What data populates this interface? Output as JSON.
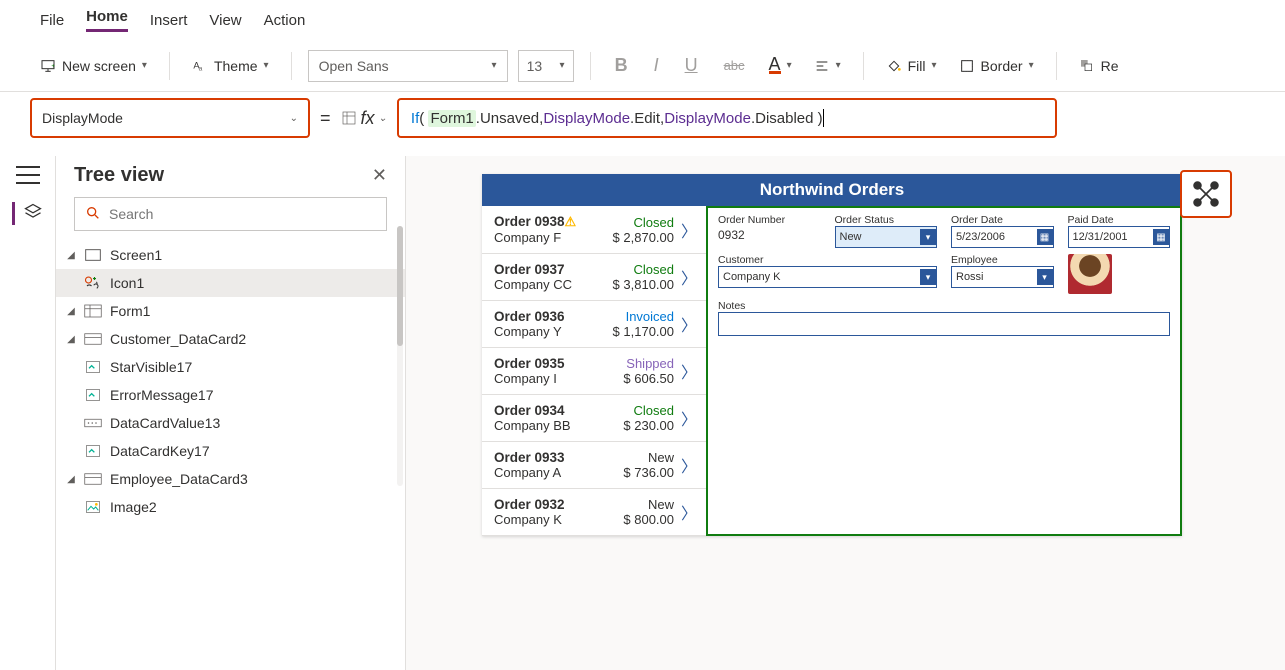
{
  "menu": {
    "file": "File",
    "home": "Home",
    "insert": "Insert",
    "view": "View",
    "action": "Action"
  },
  "toolbar": {
    "newscreen": "New screen",
    "theme": "Theme",
    "font": "Open Sans",
    "size": "13",
    "fill": "Fill",
    "border": "Border",
    "reorder": "Re"
  },
  "formula": {
    "property": "DisplayMode",
    "fn": "If",
    "id": "Form1",
    "txt1": ".Unsaved, ",
    "enum1": "DisplayMode",
    "txt2": ".Edit, ",
    "enum2": "DisplayMode",
    "txt3": ".Disabled )"
  },
  "tree": {
    "title": "Tree view",
    "search_ph": "Search",
    "screen1": "Screen1",
    "icon1": "Icon1",
    "form1": "Form1",
    "custcard": "Customer_DataCard2",
    "starvis": "StarVisible17",
    "errmsg": "ErrorMessage17",
    "dcv": "DataCardValue13",
    "dck": "DataCardKey17",
    "empcard": "Employee_DataCard3",
    "image2": "Image2"
  },
  "app": {
    "title": "Northwind Orders",
    "orders": [
      {
        "num": "Order 0938",
        "warn": true,
        "status": "Closed",
        "statcls": "closed",
        "company": "Company F",
        "amount": "$ 2,870.00"
      },
      {
        "num": "Order 0937",
        "status": "Closed",
        "statcls": "closed",
        "company": "Company CC",
        "amount": "$ 3,810.00"
      },
      {
        "num": "Order 0936",
        "status": "Invoiced",
        "statcls": "invoiced",
        "company": "Company Y",
        "amount": "$ 1,170.00"
      },
      {
        "num": "Order 0935",
        "status": "Shipped",
        "statcls": "shipped",
        "company": "Company I",
        "amount": "$ 606.50"
      },
      {
        "num": "Order 0934",
        "status": "Closed",
        "statcls": "closed",
        "company": "Company BB",
        "amount": "$ 230.00"
      },
      {
        "num": "Order 0933",
        "status": "New",
        "statcls": "new",
        "company": "Company A",
        "amount": "$ 736.00"
      },
      {
        "num": "Order 0932",
        "status": "New",
        "statcls": "new",
        "company": "Company K",
        "amount": "$ 800.00"
      }
    ],
    "form": {
      "ordnum_lbl": "Order Number",
      "ordnum": "0932",
      "ordstat_lbl": "Order Status",
      "ordstat": "New",
      "orddate_lbl": "Order Date",
      "orddate": "5/23/2006",
      "paiddate_lbl": "Paid Date",
      "paiddate": "12/31/2001",
      "cust_lbl": "Customer",
      "cust": "Company K",
      "emp_lbl": "Employee",
      "emp": "Rossi",
      "notes_lbl": "Notes"
    }
  }
}
